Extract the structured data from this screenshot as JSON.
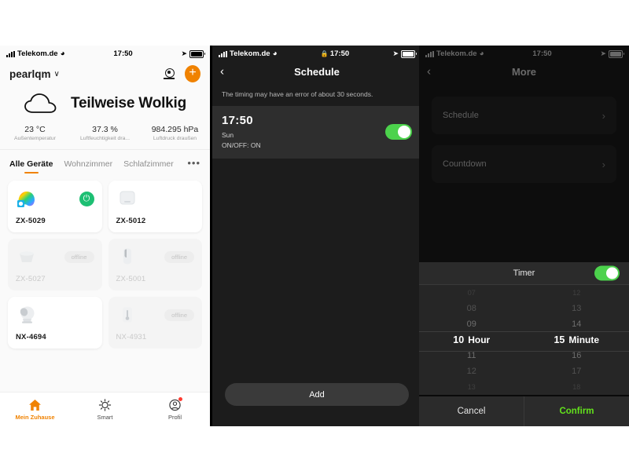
{
  "panel1": {
    "statusbar": {
      "carrier": "Telekom.de",
      "time": "17:50",
      "wifi_icon": "wifi-icon",
      "signal_icon": "signal-bars-icon",
      "location_icon": "location-arrow-icon",
      "battery_icon": "battery-icon"
    },
    "header": {
      "home_name": "pearlqm",
      "chevron": "∨",
      "scan_icon": "scan-camera-icon",
      "add_icon": "plus-icon",
      "add_label": "+"
    },
    "weather": {
      "icon": "cloud-icon",
      "condition": "Teilweise Wolkig"
    },
    "stats": [
      {
        "value": "23 °C",
        "label": "Außentemperatur"
      },
      {
        "value": "37.3 %",
        "label": "Luftfeuchtigkeit dra..."
      },
      {
        "value": "984.295 hPa",
        "label": "Luftdruck draußen"
      }
    ],
    "tabs": [
      {
        "label": "Alle Geräte",
        "active": true
      },
      {
        "label": "Wohnzimmer",
        "active": false
      },
      {
        "label": "Schlafzimmer",
        "active": false
      }
    ],
    "tabs_more": "•••",
    "devices": [
      {
        "name": "ZX-5029",
        "icon": "rgb-led-strip-icon",
        "online": true,
        "control": "power-button",
        "control_label": "⏻"
      },
      {
        "name": "ZX-5012",
        "icon": "smart-switch-icon",
        "online": true,
        "control": "none",
        "control_label": ""
      },
      {
        "name": "ZX-5027",
        "icon": "smart-socket-icon",
        "online": false,
        "control": "offline-badge",
        "control_label": "offline"
      },
      {
        "name": "ZX-5001",
        "icon": "motion-sensor-icon",
        "online": false,
        "control": "offline-badge",
        "control_label": "offline"
      },
      {
        "name": "NX-4694",
        "icon": "ip-camera-icon",
        "online": true,
        "control": "none",
        "control_label": ""
      },
      {
        "name": "NX-4931",
        "icon": "thermometer-sensor-icon",
        "online": false,
        "control": "offline-badge",
        "control_label": "offline"
      }
    ],
    "tabbar": [
      {
        "label": "Mein Zuhause",
        "icon": "home-icon",
        "active": true
      },
      {
        "label": "Smart",
        "icon": "sun-automation-icon",
        "active": false
      },
      {
        "label": "Profil",
        "icon": "profile-icon",
        "active": false,
        "badge": true
      }
    ]
  },
  "panel2": {
    "statusbar": {
      "carrier": "Telekom.de",
      "time": "17:50",
      "lock_icon": "lock-icon"
    },
    "navbar": {
      "back_icon": "chevron-left-icon",
      "back_label": "‹",
      "title": "Schedule"
    },
    "hint": "The timing may have an error of about 30 seconds.",
    "schedule": {
      "time": "17:50",
      "days": "Sun",
      "state": "ON/OFF: ON",
      "toggle_on": true
    },
    "add_button": "Add"
  },
  "panel3": {
    "statusbar": {
      "carrier": "Telekom.de",
      "time": "17:50"
    },
    "navbar": {
      "back_icon": "chevron-left-icon",
      "back_label": "‹",
      "title": "More"
    },
    "menu": [
      {
        "label": "Schedule",
        "chevron": "›"
      },
      {
        "label": "Countdown",
        "chevron": "›"
      }
    ],
    "picker": {
      "title": "Timer",
      "toggle_on": true,
      "hours": {
        "above2": "07",
        "above1": "08",
        "above0": "09",
        "selected": "10",
        "unit": "Hour",
        "below0": "11",
        "below1": "12",
        "below2": "13"
      },
      "minutes": {
        "above2": "12",
        "above1": "13",
        "above0": "14",
        "selected": "15",
        "unit": "Minute",
        "below0": "16",
        "below1": "17",
        "below2": "18"
      },
      "cancel": "Cancel",
      "confirm": "Confirm"
    }
  },
  "colors": {
    "accent_orange": "#f08200",
    "toggle_green": "#4cd24c",
    "confirm_green": "#63e21c",
    "power_green": "#1dbf73"
  }
}
